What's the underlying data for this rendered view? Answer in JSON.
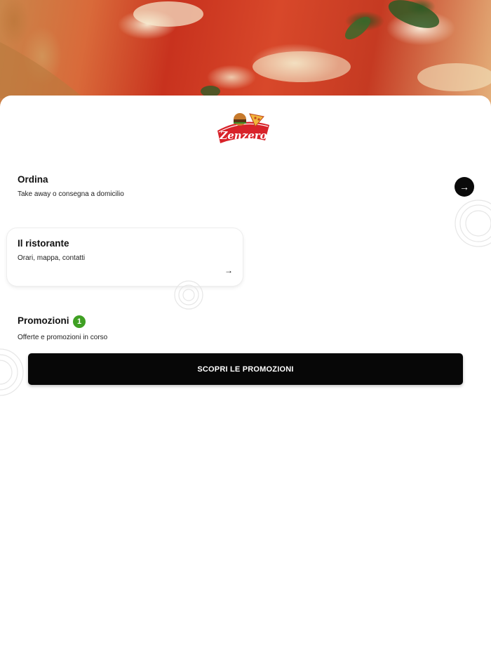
{
  "hero": {
    "image": "pizza-photo"
  },
  "brand": {
    "name": "Zenzero"
  },
  "order": {
    "title": "Ordina",
    "subtitle": "Take away o consegna a domicilio",
    "arrow": "→"
  },
  "restaurant": {
    "title": "Il ristorante",
    "subtitle": "Orari, mappa, contatti",
    "arrow": "→"
  },
  "promotions": {
    "title": "Promozioni",
    "count": "1",
    "subtitle": "Offerte e promozioni in corso",
    "button_label": "SCOPRI LE PROMOZIONI"
  },
  "colors": {
    "accent": "#000000",
    "badge": "#3fa023",
    "logo_red": "#d8232a"
  }
}
